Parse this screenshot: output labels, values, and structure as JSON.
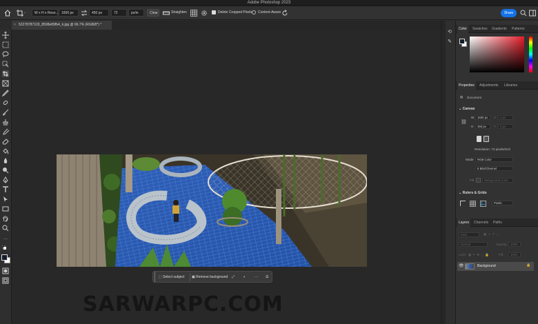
{
  "app": {
    "title": "Adobe Photoshop 2023"
  },
  "options_bar": {
    "ratio": "W x H x Reso...",
    "width": "1600 px",
    "height": "450 px",
    "resolution": "72",
    "units": "px/in",
    "clear": "Clear",
    "straighten": "Straighten",
    "delete_cropped": "Delete Cropped Pixels",
    "content_aware": "Content-Aware",
    "share": "Share"
  },
  "document": {
    "tab_label": "522787871​03_8598e89fb4_k.jpg @ 66.7% (RGB/8*) *"
  },
  "context_bar": {
    "select_subject": "Select subject",
    "remove_background": "Remove background"
  },
  "watermark": "SARWARPC.COM",
  "color_panel": {
    "tabs": [
      "Color",
      "Swatches",
      "Gradients",
      "Patterns"
    ],
    "hue_color": "#e61e2a"
  },
  "properties_panel": {
    "tabs": [
      "Properties",
      "Adjustments",
      "Libraries"
    ],
    "document_label": "Document",
    "canvas_title": "Canvas",
    "w_label": "W",
    "w_value": "1600 px",
    "h_label": "H",
    "h_value": "450 px",
    "x_label": "X",
    "x_value": "0 px",
    "y_label": "Y",
    "y_value": "0 px",
    "resolution": "Resolution: 72 pixels/inch",
    "mode_label": "Mode",
    "mode_value": "RGB Color",
    "bits_value": "8 Bits/Channel",
    "fill_label": "Fill",
    "fill_value": "Background Color",
    "rulers_title": "Rulers & Grids",
    "units_value": "Pixels"
  },
  "layers_panel": {
    "tabs": [
      "Layers",
      "Channels",
      "Paths"
    ],
    "kind": "Kind",
    "blend": "Normal",
    "opacity_label": "Opacity:",
    "opacity_value": "100%",
    "lock_label": "Lock:",
    "fill_label": "Fill:",
    "fill_value": "100%",
    "layer_name": "Background"
  }
}
